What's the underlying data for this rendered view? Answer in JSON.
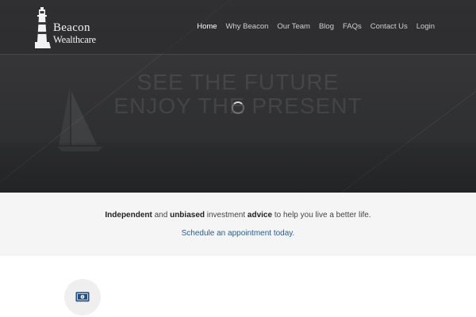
{
  "brand": {
    "line1": "Beacon",
    "line2": "Wealthcare"
  },
  "nav": {
    "items": [
      {
        "label": "Home",
        "active": true
      },
      {
        "label": "Why Beacon"
      },
      {
        "label": "Our Team"
      },
      {
        "label": "Blog"
      },
      {
        "label": "FAQs"
      },
      {
        "label": "Contact Us"
      },
      {
        "label": "Login"
      }
    ]
  },
  "hero": {
    "headline_line1": "SEE THE FUTURE",
    "headline_line2": "ENJOY THE PRESENT",
    "spinner_icon": "loading-spinner-icon"
  },
  "tagline": {
    "w1": "Independent",
    "t1": " and ",
    "w2": "unbiased",
    "t2": " investment ",
    "w3": "advice",
    "t3": " to help you live a better life.",
    "cta": "Schedule an appointment today."
  },
  "features": {
    "first_icon": "money-icon"
  },
  "colors": {
    "hero_bg": "#333335",
    "tagline_bg": "#f5f5f5",
    "link": "#2a5d8f",
    "icon_blue": "#1f4f8a"
  }
}
